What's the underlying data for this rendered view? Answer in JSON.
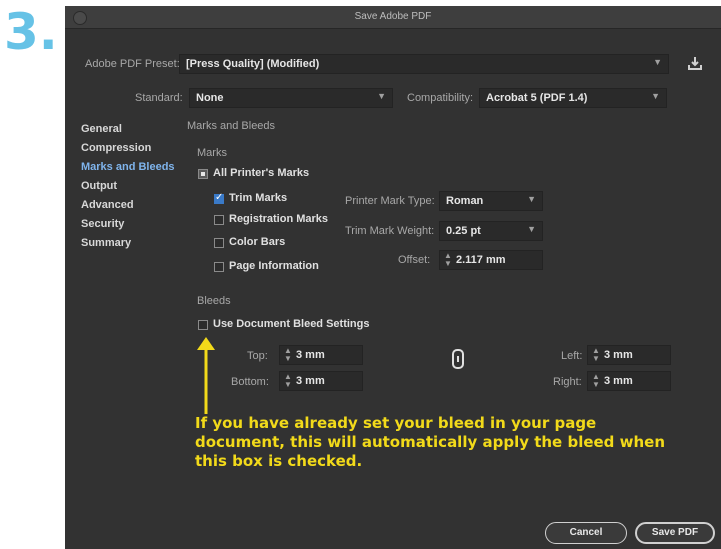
{
  "step_number": "3.",
  "window": {
    "title": "Save Adobe PDF"
  },
  "preset": {
    "label": "Adobe PDF Preset:",
    "value": "[Press Quality] (Modified)"
  },
  "standard": {
    "label": "Standard:",
    "value": "None"
  },
  "compatibility": {
    "label": "Compatibility:",
    "value": "Acrobat 5 (PDF 1.4)"
  },
  "sidebar": {
    "items": [
      {
        "label": "General"
      },
      {
        "label": "Compression"
      },
      {
        "label": "Marks and Bleeds"
      },
      {
        "label": "Output"
      },
      {
        "label": "Advanced"
      },
      {
        "label": "Security"
      },
      {
        "label": "Summary"
      }
    ]
  },
  "panel": {
    "heading": "Marks and Bleeds",
    "marks": {
      "heading": "Marks",
      "all_printers_marks": "All Printer's Marks",
      "trim_marks": "Trim Marks",
      "registration_marks": "Registration Marks",
      "color_bars": "Color Bars",
      "page_information": "Page Information",
      "printer_mark_type": {
        "label": "Printer Mark Type:",
        "value": "Roman"
      },
      "trim_mark_weight": {
        "label": "Trim Mark Weight:",
        "value": "0.25 pt"
      },
      "offset": {
        "label": "Offset:",
        "value": "2.117 mm"
      }
    },
    "bleeds": {
      "heading": "Bleeds",
      "use_document_bleed": "Use Document Bleed Settings",
      "top": {
        "label": "Top:",
        "value": "3 mm"
      },
      "bottom": {
        "label": "Bottom:",
        "value": "3 mm"
      },
      "left": {
        "label": "Left:",
        "value": "3 mm"
      },
      "right": {
        "label": "Right:",
        "value": "3 mm"
      }
    }
  },
  "buttons": {
    "cancel": "Cancel",
    "save": "Save PDF"
  },
  "callout": "If you have already set your bleed in your page document, this will automatically apply the bleed when this box is checked.",
  "colors": {
    "step_number": "#66c2e6",
    "callout": "#f2da1a",
    "accent": "#3a7ac8"
  }
}
